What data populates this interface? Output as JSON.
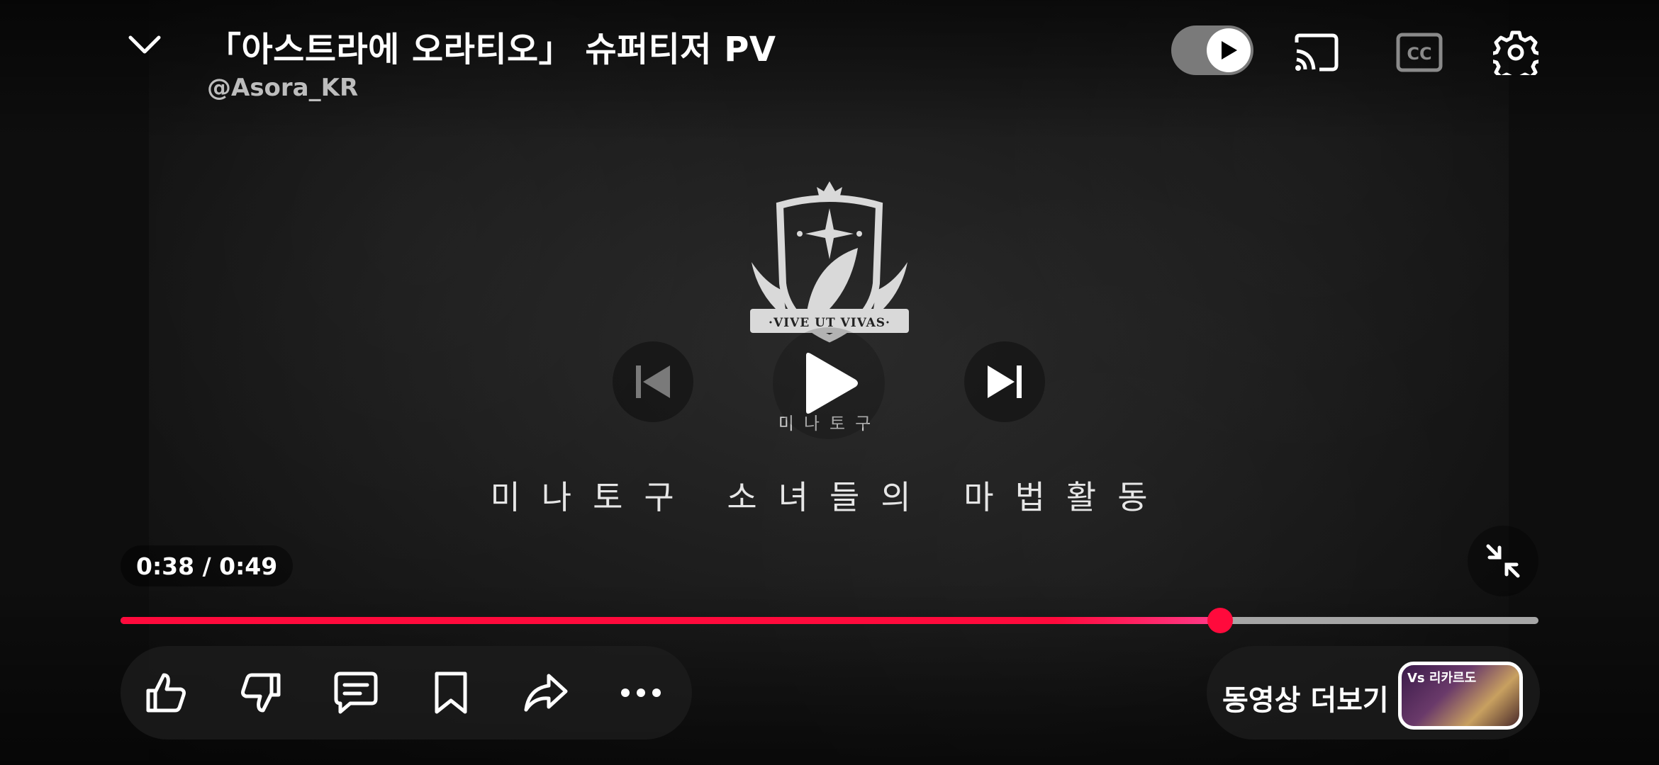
{
  "header": {
    "title": "「아스트라에 오라티오」 슈퍼티저 PV",
    "channel": "@Asora_KR"
  },
  "video": {
    "crest_motto": "·VIVE UT VIVAS·",
    "brand_line": "미나토구",
    "tagline": "미나토구 소녀들의 마법활동"
  },
  "player": {
    "current_time": "0:38",
    "separator": " / ",
    "duration": "0:49",
    "progress_fraction": 0.7755,
    "accent_color": "#ff0a3c",
    "autoplay_on": true
  },
  "icons": {
    "collapse": "chevron-down-icon",
    "autoplay": "autoplay-toggle-icon",
    "cast": "cast-icon",
    "captions": "cc-icon",
    "settings": "gear-icon",
    "previous": "skip-previous-icon",
    "play": "play-icon",
    "next": "skip-next-icon",
    "fullscreen_exit": "exit-fullscreen-icon"
  },
  "actions": [
    "like",
    "dislike",
    "comment",
    "save",
    "share",
    "more"
  ],
  "more_videos": {
    "label": "동영상 더보기",
    "thumbnail_text": "Vs 리카르도"
  }
}
